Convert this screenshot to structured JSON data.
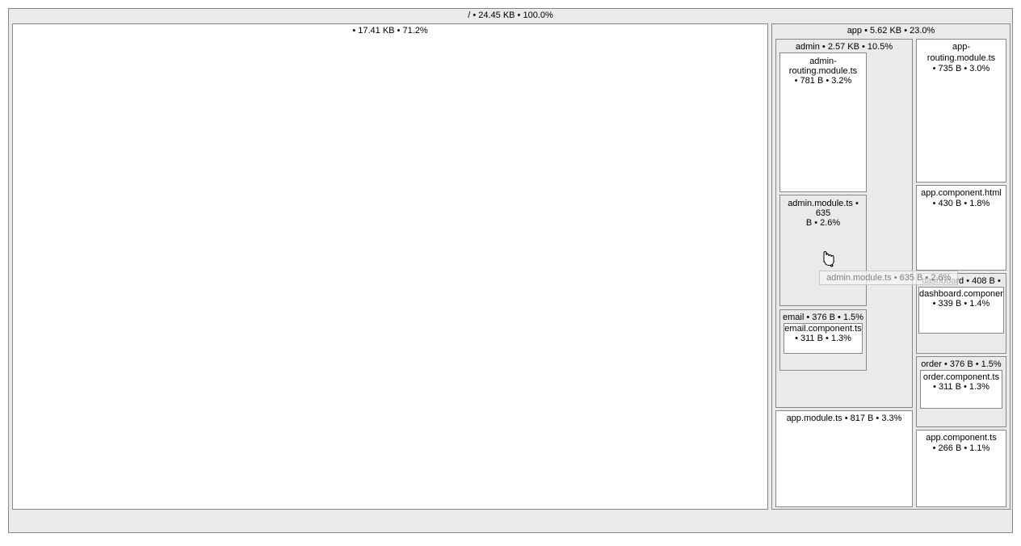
{
  "root": {
    "label": "/ • 24.45 KB • 100.0%"
  },
  "blank": {
    "label": " • 17.41 KB • 71.2%"
  },
  "app": {
    "label": "app • 5.62 KB • 23.0%"
  },
  "admin": {
    "label": "admin • 2.57 KB • 10.5%",
    "routing": {
      "line1": "admin-",
      "line2": "routing.module.ts",
      "line3": "• 781 B • 3.2%"
    },
    "module": {
      "line1": "admin.module.ts • 635",
      "line2": "B • 2.6%"
    }
  },
  "email": {
    "label": "email • 376 B • 1.5%",
    "inner": {
      "line1": "email.component.ts",
      "line2": "• 311 B • 1.3%"
    }
  },
  "appmodule": {
    "label": "app.module.ts • 817 B • 3.3%"
  },
  "approuting": {
    "line1": "app-routing.module.ts",
    "line2": "• 735 B • 3.0%"
  },
  "appcomphtml": {
    "line1": "app.component.html",
    "line2": "• 430 B • 1.8%"
  },
  "dashboard": {
    "label": "dashboard • 408 B •",
    "inner": {
      "line1": "dashboard.component",
      "line2": "• 339 B • 1.4%"
    }
  },
  "order": {
    "label": "order • 376 B • 1.5%",
    "inner": {
      "line1": "order.component.ts",
      "line2": "• 311 B • 1.3%"
    }
  },
  "appcompts": {
    "line1": "app.component.ts",
    "line2": "• 266 B • 1.1%"
  },
  "tooltip": {
    "label": "admin.module.ts • 635 B • 2.6%"
  }
}
